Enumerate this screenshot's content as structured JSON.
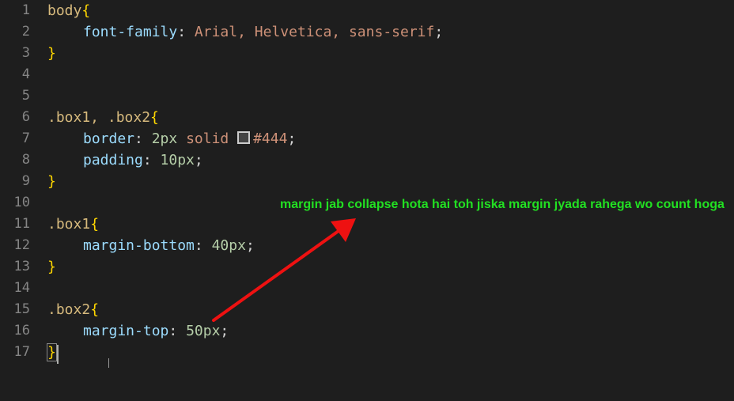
{
  "gutter": {
    "line_numbers": [
      "1",
      "2",
      "3",
      "4",
      "5",
      "6",
      "7",
      "8",
      "9",
      "10",
      "11",
      "12",
      "13",
      "14",
      "15",
      "16",
      "17"
    ]
  },
  "code": {
    "line1": {
      "selector": "body",
      "open": "{"
    },
    "line2": {
      "property": "font-family",
      "colon": ": ",
      "values": "Arial, Helvetica, sans-serif",
      "semi": ";"
    },
    "line3": {
      "close": "}"
    },
    "line6": {
      "selector": ".box1, .box2",
      "open": "{"
    },
    "line7": {
      "property": "border",
      "colon": ": ",
      "num": "2px",
      "keyword": " solid ",
      "color": "#444",
      "semi": ";"
    },
    "line8": {
      "property": "padding",
      "colon": ": ",
      "num": "10px",
      "semi": ";"
    },
    "line9": {
      "close": "}"
    },
    "line11": {
      "selector": ".box1",
      "open": "{"
    },
    "line12": {
      "property": "margin-bottom",
      "colon": ": ",
      "num": "40px",
      "semi": ";"
    },
    "line13": {
      "close": "}"
    },
    "line15": {
      "selector": ".box2",
      "open": "{"
    },
    "line16": {
      "property": "margin-top",
      "colon": ": ",
      "num": "50px",
      "semi": ";"
    },
    "line17": {
      "close": "}"
    }
  },
  "annotation": {
    "text": "margin jab collapse hota hai toh jiska margin jyada rahega wo count hoga",
    "color": "#22e022",
    "arrow_color": "#ee1111"
  },
  "icons": {
    "swatch": "color-swatch-icon",
    "arrow": "red-arrow-icon"
  }
}
